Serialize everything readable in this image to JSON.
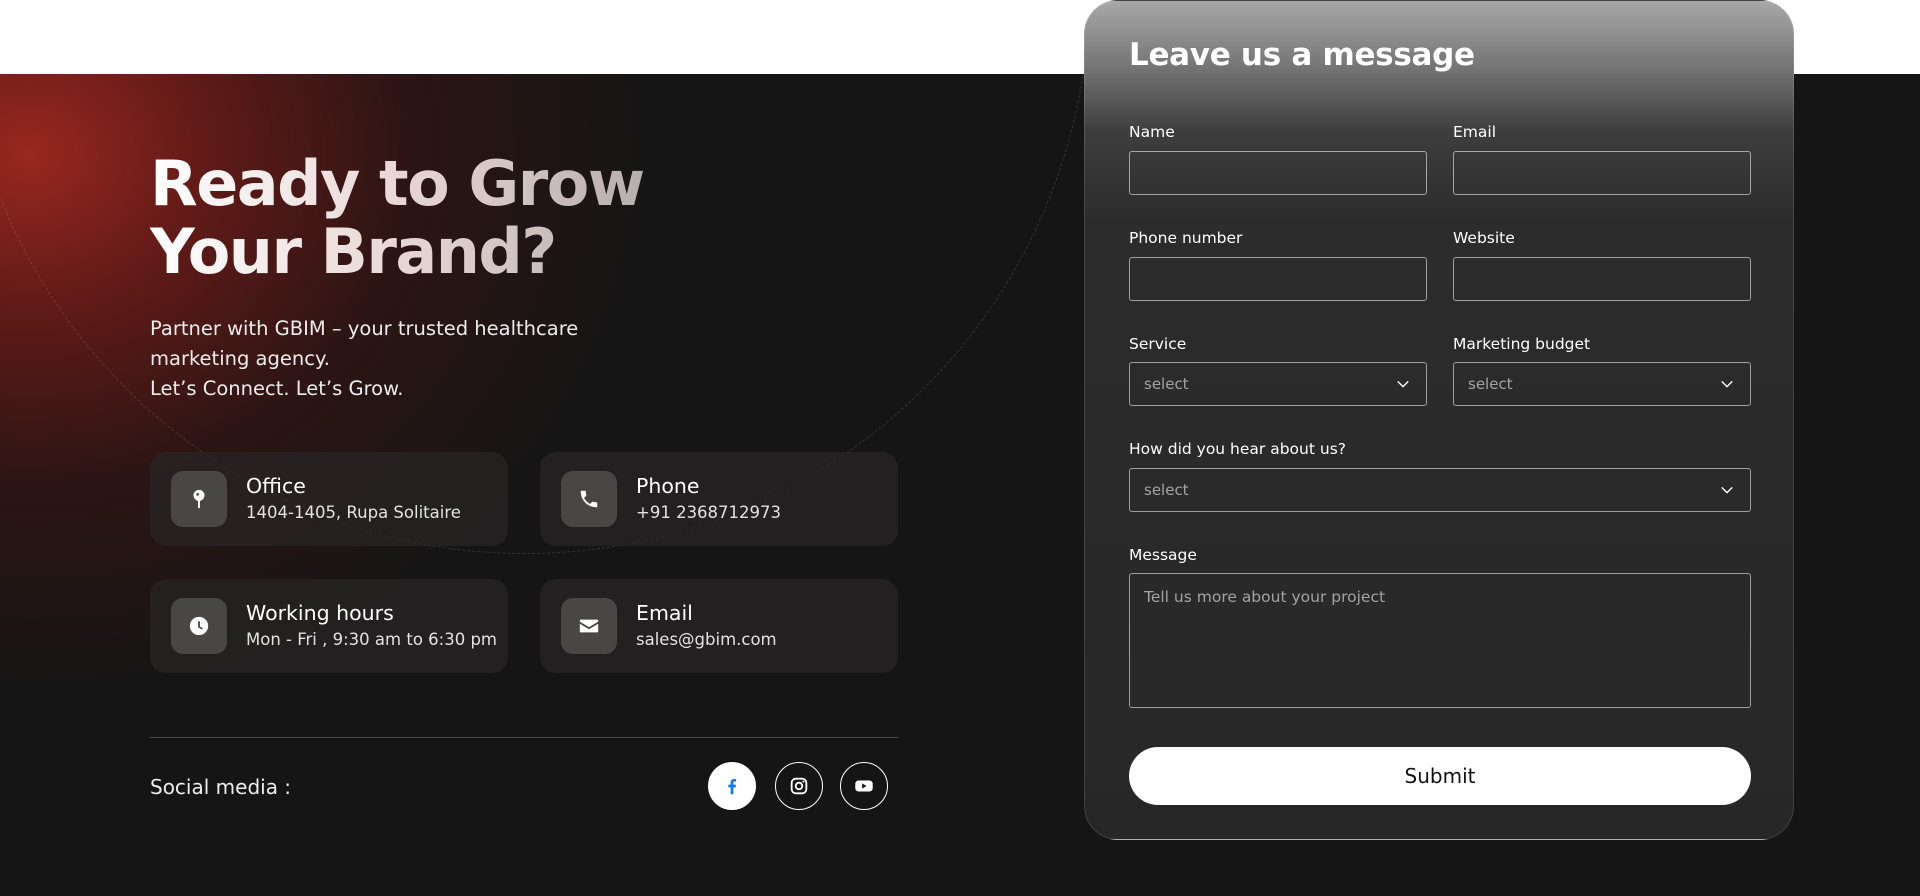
{
  "hero": {
    "headline_line1": "Ready to Grow",
    "headline_line2": "Your Brand?",
    "intro_line1": "Partner with GBIM – your trusted healthcare",
    "intro_line2": "marketing agency.",
    "intro_line3": "Let’s Connect. Let’s Grow."
  },
  "contact_cards": [
    {
      "icon": "location-pin-icon",
      "title": "Office",
      "detail": "1404-1405, Rupa Solitaire"
    },
    {
      "icon": "phone-icon",
      "title": "Phone",
      "detail": "+91 2368712973"
    },
    {
      "icon": "clock-icon",
      "title": "Working hours",
      "detail": "Mon - Fri , 9:30 am to 6:30 pm"
    },
    {
      "icon": "envelope-icon",
      "title": "Email",
      "detail": "sales@gbim.com"
    }
  ],
  "social": {
    "label": "Social media :",
    "items": [
      {
        "name": "facebook",
        "icon": "facebook-icon",
        "active": true
      },
      {
        "name": "instagram",
        "icon": "instagram-icon",
        "active": false
      },
      {
        "name": "youtube",
        "icon": "youtube-icon",
        "active": false
      }
    ]
  },
  "form": {
    "title": "Leave us a message",
    "name_label": "Name",
    "name_value": "",
    "email_label": "Email",
    "email_value": "",
    "phone_label": "Phone number",
    "phone_value": "",
    "website_label": "Website",
    "website_value": "",
    "service_label": "Service",
    "service_selected": "select",
    "budget_label": "Marketing budget",
    "budget_selected": "select",
    "source_label": "How did you hear about us?",
    "source_selected": "select",
    "message_label": "Message",
    "message_placeholder": "Tell us more about your project",
    "submit_label": "Submit"
  },
  "colors": {
    "background": "#151515",
    "accent_glow": "#a02820",
    "facebook_blue": "#1877f2",
    "button_bg": "#ffffff"
  }
}
